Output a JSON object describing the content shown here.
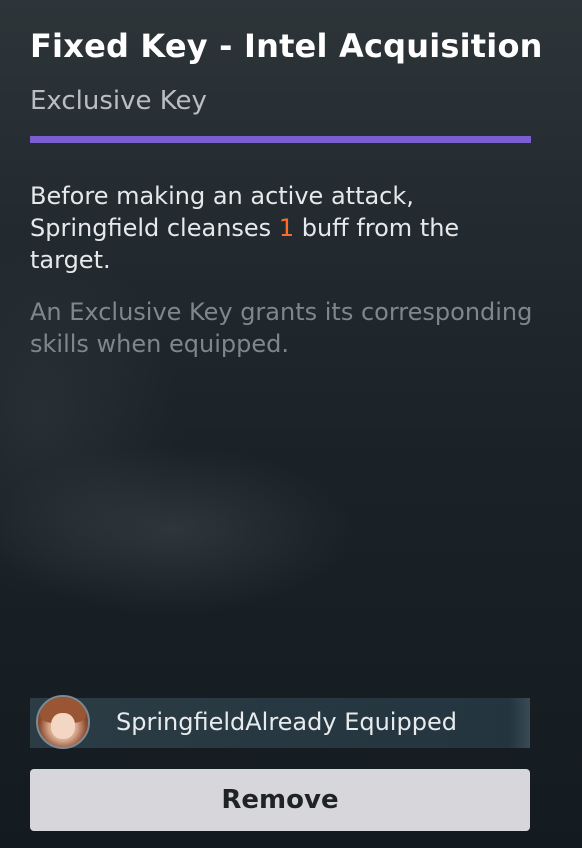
{
  "item": {
    "title": "Fixed Key - Intel Acquisition",
    "type": "Exclusive Key",
    "rarity_color": "#7a5fd0"
  },
  "description": {
    "part1": "Before making an active attack, Springfield cleanses ",
    "number": "1",
    "number_color": "#ff6b2a",
    "part2": " buff from the target."
  },
  "note": "An Exclusive Key grants its corresponding skills when equipped.",
  "equipped": {
    "character": "Springfield",
    "status": "Already Equipped",
    "avatar_icon": "character-portrait"
  },
  "actions": {
    "remove_label": "Remove"
  }
}
